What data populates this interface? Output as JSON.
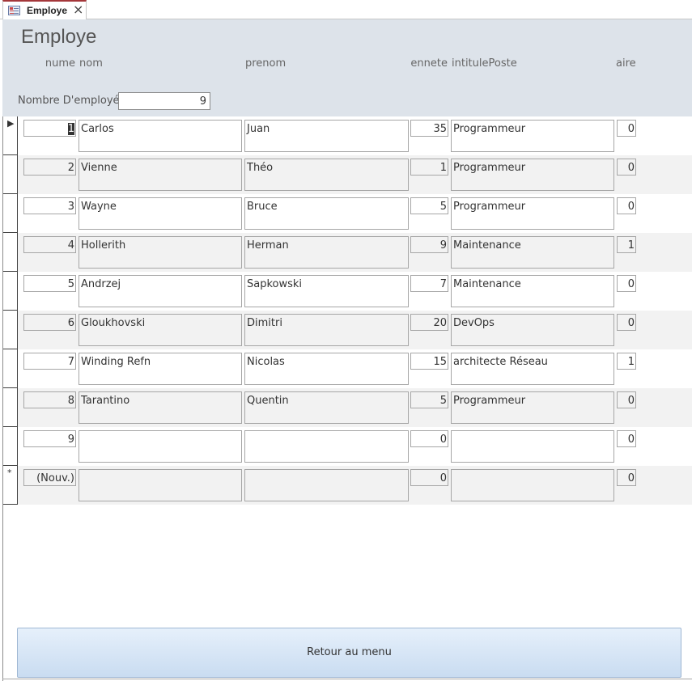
{
  "tab": {
    "label": "Employe",
    "icon": "form-icon",
    "close_icon": "close-icon"
  },
  "form": {
    "title": "Employe",
    "columns": [
      "nume",
      "nom",
      "prenom",
      "ennete",
      "intitulePoste",
      "aire"
    ],
    "count_label": "Nombre D'employé",
    "count_value": "9"
  },
  "rows": [
    {
      "id": "1",
      "nom": "Carlos",
      "prenom": "Juan",
      "anciennete": "35",
      "poste": "Programmeur",
      "salaire": "0",
      "current": true
    },
    {
      "id": "2",
      "nom": "Vienne",
      "prenom": "Théo",
      "anciennete": "1",
      "poste": "Programmeur",
      "salaire": "0"
    },
    {
      "id": "3",
      "nom": "Wayne",
      "prenom": "Bruce",
      "anciennete": "5",
      "poste": "Programmeur",
      "salaire": "0"
    },
    {
      "id": "4",
      "nom": "Hollerith",
      "prenom": "Herman",
      "anciennete": "9",
      "poste": "Maintenance",
      "salaire": "1"
    },
    {
      "id": "5",
      "nom": "Andrzej",
      "prenom": "Sapkowski",
      "anciennete": "7",
      "poste": "Maintenance",
      "salaire": "0"
    },
    {
      "id": "6",
      "nom": "Gloukhovski",
      "prenom": "Dimitri",
      "anciennete": "20",
      "poste": "DevOps",
      "salaire": "0"
    },
    {
      "id": "7",
      "nom": "Winding Refn",
      "prenom": "Nicolas",
      "anciennete": "15",
      "poste": "architecte  Réseau",
      "salaire": "1"
    },
    {
      "id": "8",
      "nom": "Tarantino",
      "prenom": "Quentin",
      "anciennete": "5",
      "poste": "Programmeur",
      "salaire": "0"
    },
    {
      "id": "9",
      "nom": "",
      "prenom": "",
      "anciennete": "0",
      "poste": "",
      "salaire": "0"
    },
    {
      "id": "(Nouv.)",
      "nom": "",
      "prenom": "",
      "anciennete": "0",
      "poste": "",
      "salaire": "0",
      "new_record": true
    }
  ],
  "selector_marks": {
    "current": "▶",
    "new": "*"
  },
  "menu_button": {
    "label": "Retour au menu"
  },
  "colors": {
    "header_bg": "#dde3ea",
    "alt_row_bg": "#f2f2f2",
    "tab_accent": "#a4373a",
    "button_bg": "#c9dcf1"
  }
}
